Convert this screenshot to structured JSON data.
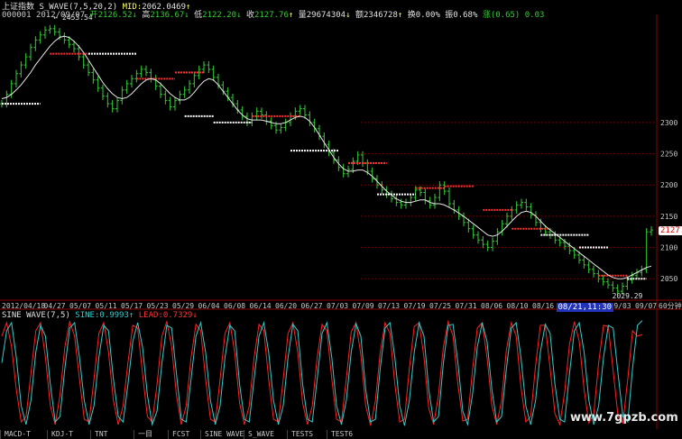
{
  "header": {
    "index_name": "上证指数",
    "indicator": "S_WAVE(7,5,20,2)",
    "mid_label": "MID:",
    "mid_value": "2062.0469",
    "arrow_up": "↑",
    "code": "000001",
    "date": "2012/09/07",
    "open_label": "开",
    "open_value": "2126.52",
    "high_label": "高",
    "high_value": "2136.67",
    "low_label": "低",
    "low_value": "2122.20",
    "close_label": "收",
    "close_value": "2127.76",
    "volume_label": "量",
    "volume_value": "29674304",
    "amount_label": "额",
    "amount_value": "2346728",
    "turnover_label": "换",
    "turnover_value": "0.00%",
    "amplitude_label": "振",
    "amplitude_value": "0.68%",
    "change_label": "涨",
    "change_value": "(0.65)",
    "change_pct": "0.03",
    "arrow_down": "↓"
  },
  "sub_header": {
    "name": "SINE WAVE(7,5)",
    "sine_label": "SINE:",
    "sine_value": "0.9993",
    "lead_label": "LEAD:",
    "lead_value": "0.7329"
  },
  "chart_data": {
    "type": "line",
    "y_ticks": [
      "2300",
      "2250",
      "2200",
      "2150",
      "2100",
      "2050"
    ],
    "ylim": [
      2020,
      2470
    ],
    "x_ticks": [
      "2012/04/18",
      "04/27",
      "05/07",
      "05/11",
      "05/17",
      "05/23",
      "05/29",
      "06/04",
      "06/08",
      "06/14",
      "06/20",
      "06/27",
      "07/03",
      "07/09",
      "07/13",
      "07/19",
      "07/25",
      "07/31",
      "08/06",
      "08/10",
      "08/16",
      "08/21,11:30",
      "/28",
      "09/03",
      "09/07"
    ],
    "cursor_tick_index": 21,
    "x_unit_label": "60分钟",
    "annotations": {
      "high": "2453.54",
      "low": "2029.29",
      "last": "2127.8"
    },
    "price": [
      2330,
      2345,
      2362,
      2378,
      2392,
      2405,
      2420,
      2432,
      2440,
      2448,
      2450,
      2445,
      2438,
      2432,
      2425,
      2418,
      2405,
      2392,
      2380,
      2368,
      2355,
      2342,
      2330,
      2322,
      2335,
      2352,
      2362,
      2370,
      2378,
      2385,
      2380,
      2370,
      2358,
      2345,
      2335,
      2325,
      2335,
      2345,
      2352,
      2362,
      2375,
      2385,
      2392,
      2385,
      2372,
      2360,
      2350,
      2340,
      2330,
      2320,
      2310,
      2300,
      2310,
      2318,
      2312,
      2302,
      2295,
      2288,
      2292,
      2300,
      2310,
      2318,
      2322,
      2312,
      2300,
      2290,
      2278,
      2265,
      2252,
      2240,
      2228,
      2218,
      2225,
      2238,
      2248,
      2235,
      2222,
      2210,
      2200,
      2192,
      2185,
      2178,
      2172,
      2168,
      2172,
      2180,
      2192,
      2188,
      2175,
      2168,
      2180,
      2200,
      2190,
      2170,
      2160,
      2150,
      2140,
      2130,
      2120,
      2112,
      2105,
      2100,
      2110,
      2125,
      2138,
      2150,
      2160,
      2168,
      2172,
      2165,
      2152,
      2140,
      2130,
      2125,
      2120,
      2112,
      2108,
      2102,
      2095,
      2088,
      2080,
      2072,
      2065,
      2058,
      2050,
      2045,
      2040,
      2035,
      2030,
      2038,
      2048,
      2055,
      2060,
      2065,
      2125,
      2128
    ],
    "ma": [
      2338,
      2340,
      2345,
      2352,
      2360,
      2370,
      2380,
      2392,
      2402,
      2412,
      2422,
      2430,
      2436,
      2438,
      2436,
      2430,
      2422,
      2412,
      2400,
      2388,
      2376,
      2364,
      2354,
      2346,
      2340,
      2338,
      2340,
      2346,
      2354,
      2362,
      2368,
      2370,
      2368,
      2362,
      2354,
      2346,
      2340,
      2336,
      2336,
      2340,
      2348,
      2358,
      2366,
      2370,
      2368,
      2360,
      2350,
      2340,
      2330,
      2320,
      2312,
      2306,
      2304,
      2304,
      2304,
      2302,
      2300,
      2298,
      2298,
      2300,
      2304,
      2308,
      2310,
      2308,
      2302,
      2292,
      2280,
      2268,
      2256,
      2244,
      2234,
      2226,
      2222,
      2222,
      2224,
      2224,
      2220,
      2214,
      2206,
      2198,
      2190,
      2184,
      2178,
      2174,
      2172,
      2172,
      2174,
      2176,
      2176,
      2172,
      2170,
      2170,
      2168,
      2164,
      2160,
      2155,
      2150,
      2144,
      2138,
      2132,
      2126,
      2120,
      2118,
      2120,
      2126,
      2134,
      2142,
      2150,
      2156,
      2158,
      2156,
      2150,
      2142,
      2134,
      2128,
      2122,
      2116,
      2110,
      2104,
      2098,
      2092,
      2086,
      2080,
      2074,
      2068,
      2062,
      2056,
      2052,
      2050,
      2050,
      2052,
      2056,
      2060,
      2064,
      2068,
      2070
    ],
    "sine": [
      0.2,
      0.8,
      0.95,
      0.3,
      -0.6,
      -0.95,
      -0.5,
      0.4,
      0.9,
      0.7,
      -0.2,
      -0.9,
      -0.8,
      0.1,
      0.85,
      0.95,
      0.3,
      -0.5,
      -0.95,
      -0.6,
      0.3,
      0.9,
      0.8,
      -0.1,
      -0.8,
      -0.9,
      -0.2,
      0.6,
      0.95,
      0.5,
      -0.4,
      -0.95,
      -0.7,
      0.2,
      0.9,
      0.85,
      0.0,
      -0.85,
      -0.9,
      -0.1,
      0.7,
      0.95,
      0.4,
      -0.5,
      -0.95,
      -0.6,
      0.3,
      0.9,
      0.8,
      -0.2,
      -0.85,
      -0.9,
      -0.1,
      0.7,
      0.95,
      0.4,
      -0.5,
      -0.95,
      -0.6,
      0.3,
      0.92,
      0.8,
      -0.2,
      -0.85,
      -0.9,
      -0.1,
      0.75,
      0.95,
      0.3,
      -0.6,
      -0.95,
      -0.5,
      0.4,
      0.93,
      0.7,
      -0.3,
      -0.9,
      -0.85,
      0.1,
      0.85,
      0.95,
      0.3,
      -0.6,
      -0.97,
      -0.5,
      0.4,
      0.95,
      0.7,
      -0.3,
      -0.9,
      -0.8,
      0.2,
      0.9,
      0.92,
      0.2,
      -0.7,
      -0.95,
      -0.4,
      0.5,
      0.95,
      0.6,
      -0.3,
      -0.9,
      -0.8,
      0.1,
      0.85,
      0.95,
      0.3,
      -0.6,
      -0.95,
      -0.5,
      0.4,
      0.92,
      0.75,
      -0.2,
      -0.85,
      -0.9,
      0.0,
      0.8,
      0.95,
      0.4,
      -0.5,
      -0.95,
      -0.6,
      0.3,
      0.9,
      0.85,
      0.0,
      -0.8,
      -0.9,
      0.1,
      0.9,
      0.99
    ],
    "lead": [
      0.7,
      0.95,
      0.5,
      -0.3,
      -0.9,
      -0.8,
      0.0,
      0.8,
      0.95,
      0.3,
      -0.6,
      -0.95,
      -0.4,
      0.5,
      0.97,
      0.7,
      -0.1,
      -0.85,
      -0.9,
      -0.1,
      0.75,
      0.95,
      0.4,
      -0.5,
      -0.95,
      -0.6,
      0.2,
      0.9,
      0.85,
      0.0,
      -0.8,
      -0.9,
      -0.2,
      0.7,
      0.97,
      0.5,
      -0.4,
      -0.95,
      -0.6,
      0.3,
      0.92,
      0.8,
      -0.1,
      -0.85,
      -0.9,
      -0.1,
      0.75,
      0.95,
      0.4,
      -0.55,
      -0.95,
      -0.6,
      0.3,
      0.92,
      0.8,
      -0.1,
      -0.85,
      -0.9,
      -0.1,
      0.75,
      0.95,
      0.4,
      -0.55,
      -0.95,
      -0.6,
      0.3,
      0.92,
      0.8,
      -0.1,
      -0.85,
      -0.9,
      -0.1,
      0.78,
      0.95,
      0.35,
      -0.6,
      -0.97,
      -0.5,
      0.4,
      0.95,
      0.75,
      -0.2,
      -0.9,
      -0.85,
      0.1,
      0.88,
      0.95,
      0.3,
      -0.65,
      -0.95,
      -0.4,
      0.5,
      0.97,
      0.7,
      -0.2,
      -0.88,
      -0.85,
      0.05,
      0.85,
      0.95,
      0.3,
      -0.6,
      -0.95,
      -0.5,
      0.45,
      0.95,
      0.7,
      -0.25,
      -0.9,
      -0.8,
      0.15,
      0.9,
      0.9,
      0.1,
      -0.75,
      -0.95,
      -0.35,
      0.55,
      0.97,
      0.6,
      -0.3,
      -0.92,
      -0.75,
      0.2,
      0.9,
      0.88,
      0.05,
      -0.8,
      -0.92,
      -0.1,
      0.8,
      0.7,
      0.73
    ]
  },
  "tabs": [
    "MACD-T",
    "KDJ-T",
    "TNT",
    "一目",
    "FCST",
    "SINE WAVE",
    "S_WAVE",
    "TESTS",
    "TEST6"
  ],
  "watermark": "www.7gpzb.com",
  "colors": {
    "up": "#ff3333",
    "down": "#33cc33",
    "ma": "#e8e8e8",
    "sine": "#33cccc",
    "lead": "#ff2222",
    "grid": "#8b0000"
  }
}
